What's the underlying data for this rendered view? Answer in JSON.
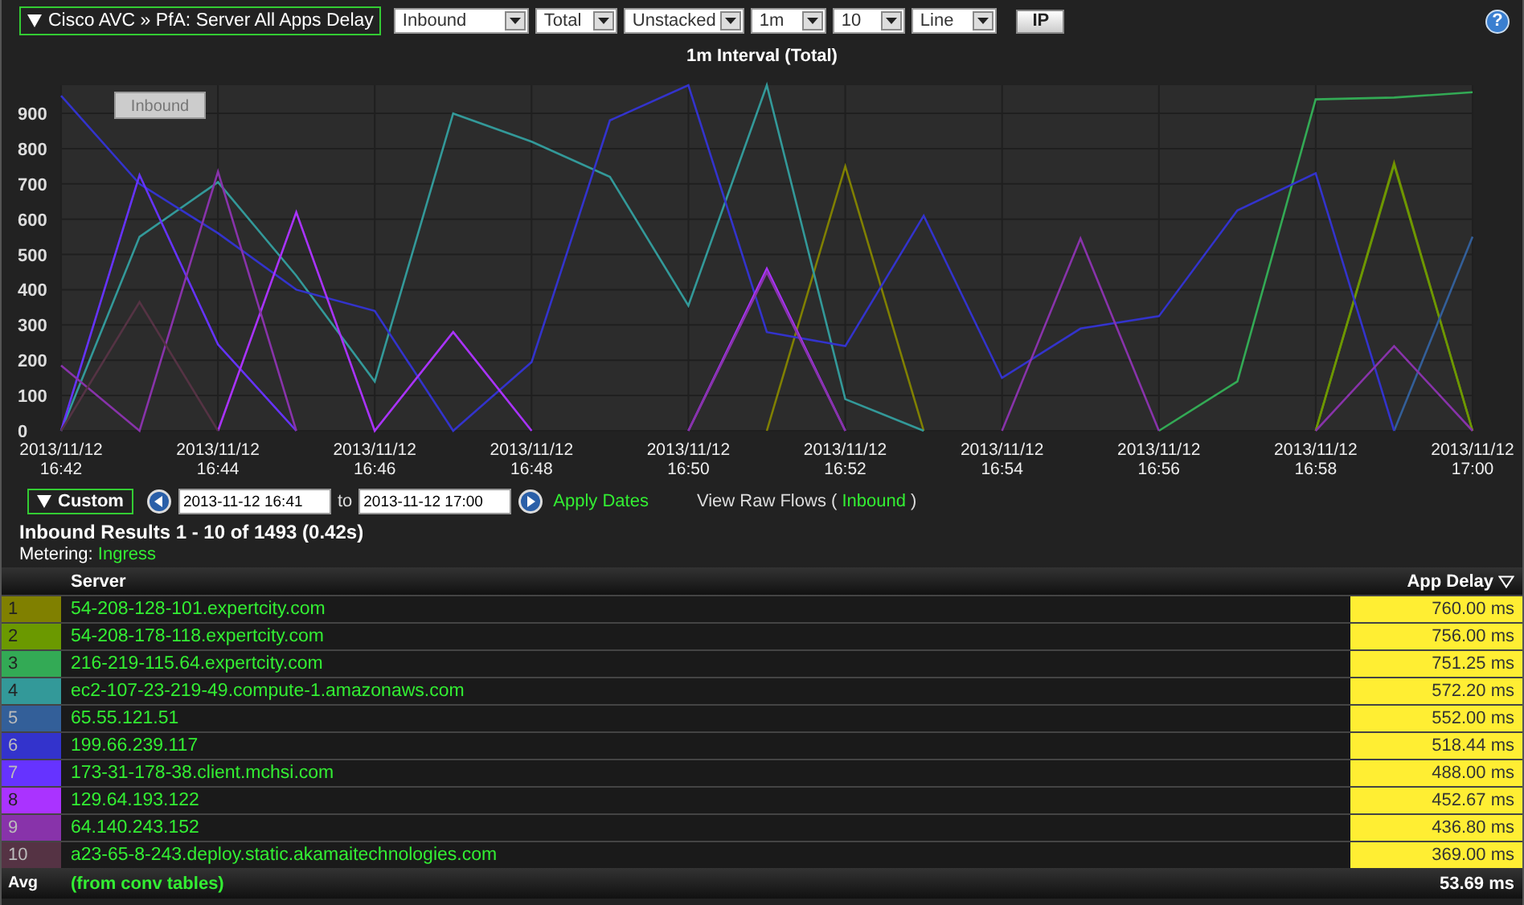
{
  "header": {
    "title": "Cisco AVC » PfA: Server All Apps Delay",
    "selects": [
      "Inbound",
      "Total",
      "Unstacked",
      "1m",
      "10",
      "Line"
    ],
    "button": "IP",
    "help": "?"
  },
  "chart": {
    "legend_label": "Inbound",
    "chart_data": {
      "type": "line",
      "title": "1m Interval (Total)",
      "categories": [
        "2013/11/12 16:42",
        null,
        "2013/11/12 16:44",
        null,
        "2013/11/12 16:46",
        null,
        "2013/11/12 16:48",
        null,
        "2013/11/12 16:50",
        null,
        "2013/11/12 16:52",
        null,
        "2013/11/12 16:54",
        null,
        "2013/11/12 16:56",
        null,
        "2013/11/12 16:58",
        null,
        "2013/11/12 17:00"
      ],
      "ylim": [
        0,
        980
      ],
      "grid": true,
      "yticks": [
        0,
        100,
        200,
        300,
        400,
        500,
        600,
        700,
        800,
        900
      ],
      "series": [
        {
          "color": "#808000",
          "values": [
            null,
            null,
            null,
            null,
            null,
            null,
            null,
            null,
            null,
            0,
            750,
            0,
            null,
            null,
            null,
            null,
            0,
            760,
            0
          ]
        },
        {
          "color": "#6b9900",
          "values": [
            null,
            null,
            null,
            null,
            null,
            null,
            null,
            null,
            null,
            null,
            null,
            null,
            null,
            null,
            null,
            null,
            0,
            755,
            0
          ]
        },
        {
          "color": "#33aa55",
          "values": [
            null,
            null,
            null,
            null,
            null,
            null,
            null,
            null,
            null,
            null,
            null,
            null,
            null,
            null,
            0,
            140,
            940,
            945,
            960
          ]
        },
        {
          "color": "#339999",
          "values": [
            0,
            550,
            705,
            440,
            140,
            900,
            820,
            720,
            355,
            980,
            90,
            0,
            null,
            null,
            null,
            null,
            null,
            null,
            null
          ]
        },
        {
          "color": "#335f99",
          "values": [
            null,
            null,
            null,
            null,
            null,
            null,
            null,
            null,
            null,
            null,
            null,
            null,
            null,
            null,
            null,
            null,
            null,
            0,
            550
          ]
        },
        {
          "color": "#3333cc",
          "values": [
            950,
            700,
            560,
            400,
            340,
            0,
            195,
            880,
            980,
            280,
            240,
            610,
            150,
            290,
            325,
            625,
            730,
            0,
            null
          ]
        },
        {
          "color": "#6633ff",
          "values": [
            0,
            725,
            245,
            0,
            null,
            null,
            null,
            null,
            null,
            null,
            null,
            null,
            null,
            null,
            null,
            null,
            null,
            null,
            null
          ]
        },
        {
          "color": "#aa33ff",
          "values": [
            null,
            null,
            0,
            620,
            0,
            280,
            0,
            null,
            0,
            460,
            0,
            null,
            null,
            null,
            null,
            null,
            null,
            null,
            null
          ]
        },
        {
          "color": "#8833aa",
          "values": [
            185,
            0,
            735,
            0,
            null,
            null,
            null,
            null,
            0,
            450,
            0,
            null,
            0,
            545,
            0,
            null,
            0,
            240,
            0
          ]
        },
        {
          "color": "#553344",
          "values": [
            0,
            365,
            0,
            null,
            null,
            null,
            null,
            null,
            null,
            null,
            null,
            null,
            null,
            null,
            null,
            null,
            null,
            null,
            null
          ]
        }
      ]
    }
  },
  "range": {
    "preset": "Custom",
    "from": "2013-11-12 16:41",
    "to_label": "to",
    "to": "2013-11-12 17:00",
    "apply": "Apply Dates",
    "raw_flows": "View Raw Flows (",
    "raw_flows_link": "Inbound",
    "raw_flows_end": ")"
  },
  "results": "Inbound Results 1 - 10 of 1493 (0.42s)",
  "metering": {
    "label": "Metering:",
    "value": "Ingress"
  },
  "table": {
    "columns": [
      "Server",
      "App Delay"
    ],
    "rows": [
      {
        "rank": "1",
        "color": "#808000",
        "server": "54-208-128-101.expertcity.com",
        "delay": "760.00 ms"
      },
      {
        "rank": "2",
        "color": "#6b9900",
        "server": "54-208-178-118.expertcity.com",
        "delay": "756.00 ms"
      },
      {
        "rank": "3",
        "color": "#33aa55",
        "server": "216-219-115.64.expertcity.com",
        "delay": "751.25 ms"
      },
      {
        "rank": "4",
        "color": "#339999",
        "server": "ec2-107-23-219-49.compute-1.amazonaws.com",
        "delay": "572.20 ms"
      },
      {
        "rank": "5",
        "color": "#335f99",
        "server": "65.55.121.51",
        "delay": "552.00 ms"
      },
      {
        "rank": "6",
        "color": "#3333cc",
        "server": "199.66.239.117",
        "delay": "518.44 ms"
      },
      {
        "rank": "7",
        "color": "#6633ff",
        "server": "173-31-178-38.client.mchsi.com",
        "delay": "488.00 ms"
      },
      {
        "rank": "8",
        "color": "#aa33ff",
        "server": "129.64.193.122",
        "delay": "452.67 ms"
      },
      {
        "rank": "9",
        "color": "#8833aa",
        "server": "64.140.243.152",
        "delay": "436.80 ms"
      },
      {
        "rank": "10",
        "color": "#553344",
        "server": "a23-65-8-243.deploy.static.akamaitechnologies.com",
        "delay": "369.00 ms"
      }
    ],
    "footer": {
      "label": "Avg",
      "note": "(from conv tables)",
      "value": "53.69 ms"
    }
  }
}
